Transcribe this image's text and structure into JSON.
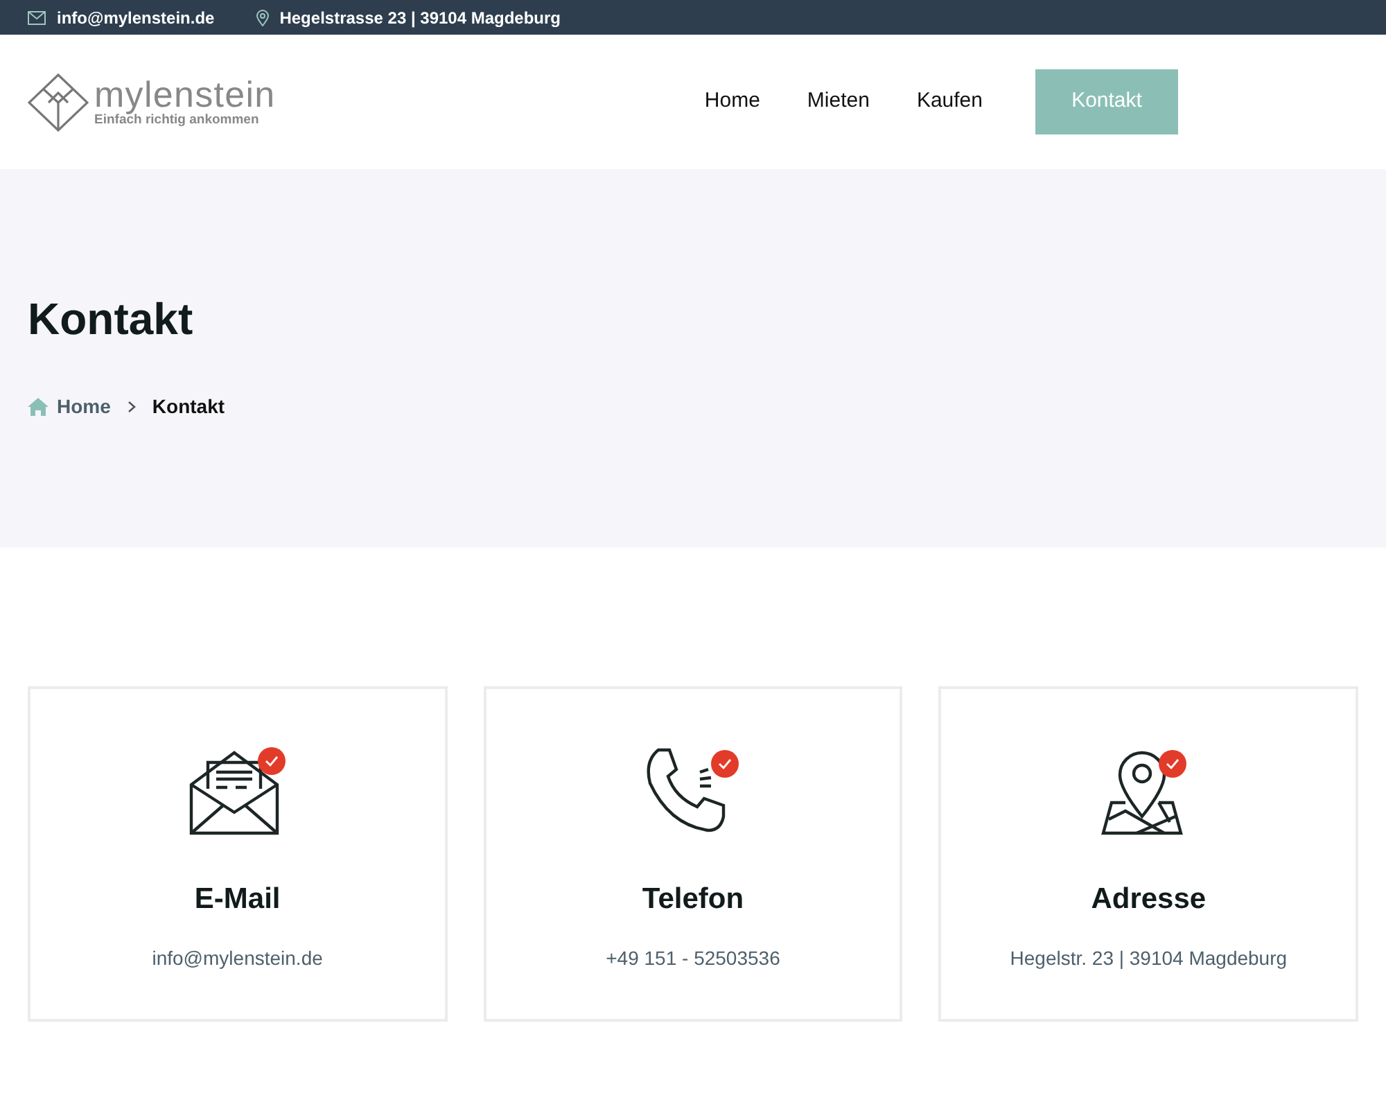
{
  "top_bar": {
    "email": "info@mylenstein.de",
    "address": "Hegelstrasse 23 | 39104 Magdeburg"
  },
  "logo": {
    "name": "mylenstein",
    "tagline": "Einfach richtig ankommen"
  },
  "nav": [
    {
      "label": "Home",
      "kind": "link"
    },
    {
      "label": "Mieten",
      "kind": "link"
    },
    {
      "label": "Kaufen",
      "kind": "link"
    },
    {
      "label": "Kontakt",
      "kind": "button"
    }
  ],
  "hero": {
    "title": "Kontakt",
    "breadcrumb": [
      {
        "label": "Home",
        "kind": "home"
      },
      {
        "label": "Kontakt",
        "kind": "current"
      }
    ]
  },
  "cards": [
    {
      "kind": "email",
      "title": "E-Mail",
      "text": "info@mylenstein.de"
    },
    {
      "kind": "phone",
      "title": "Telefon",
      "text": "+49 151 - 52503536"
    },
    {
      "kind": "address",
      "title": "Adresse",
      "text": "Hegelstr. 23 | 39104 Magdeburg"
    }
  ]
}
